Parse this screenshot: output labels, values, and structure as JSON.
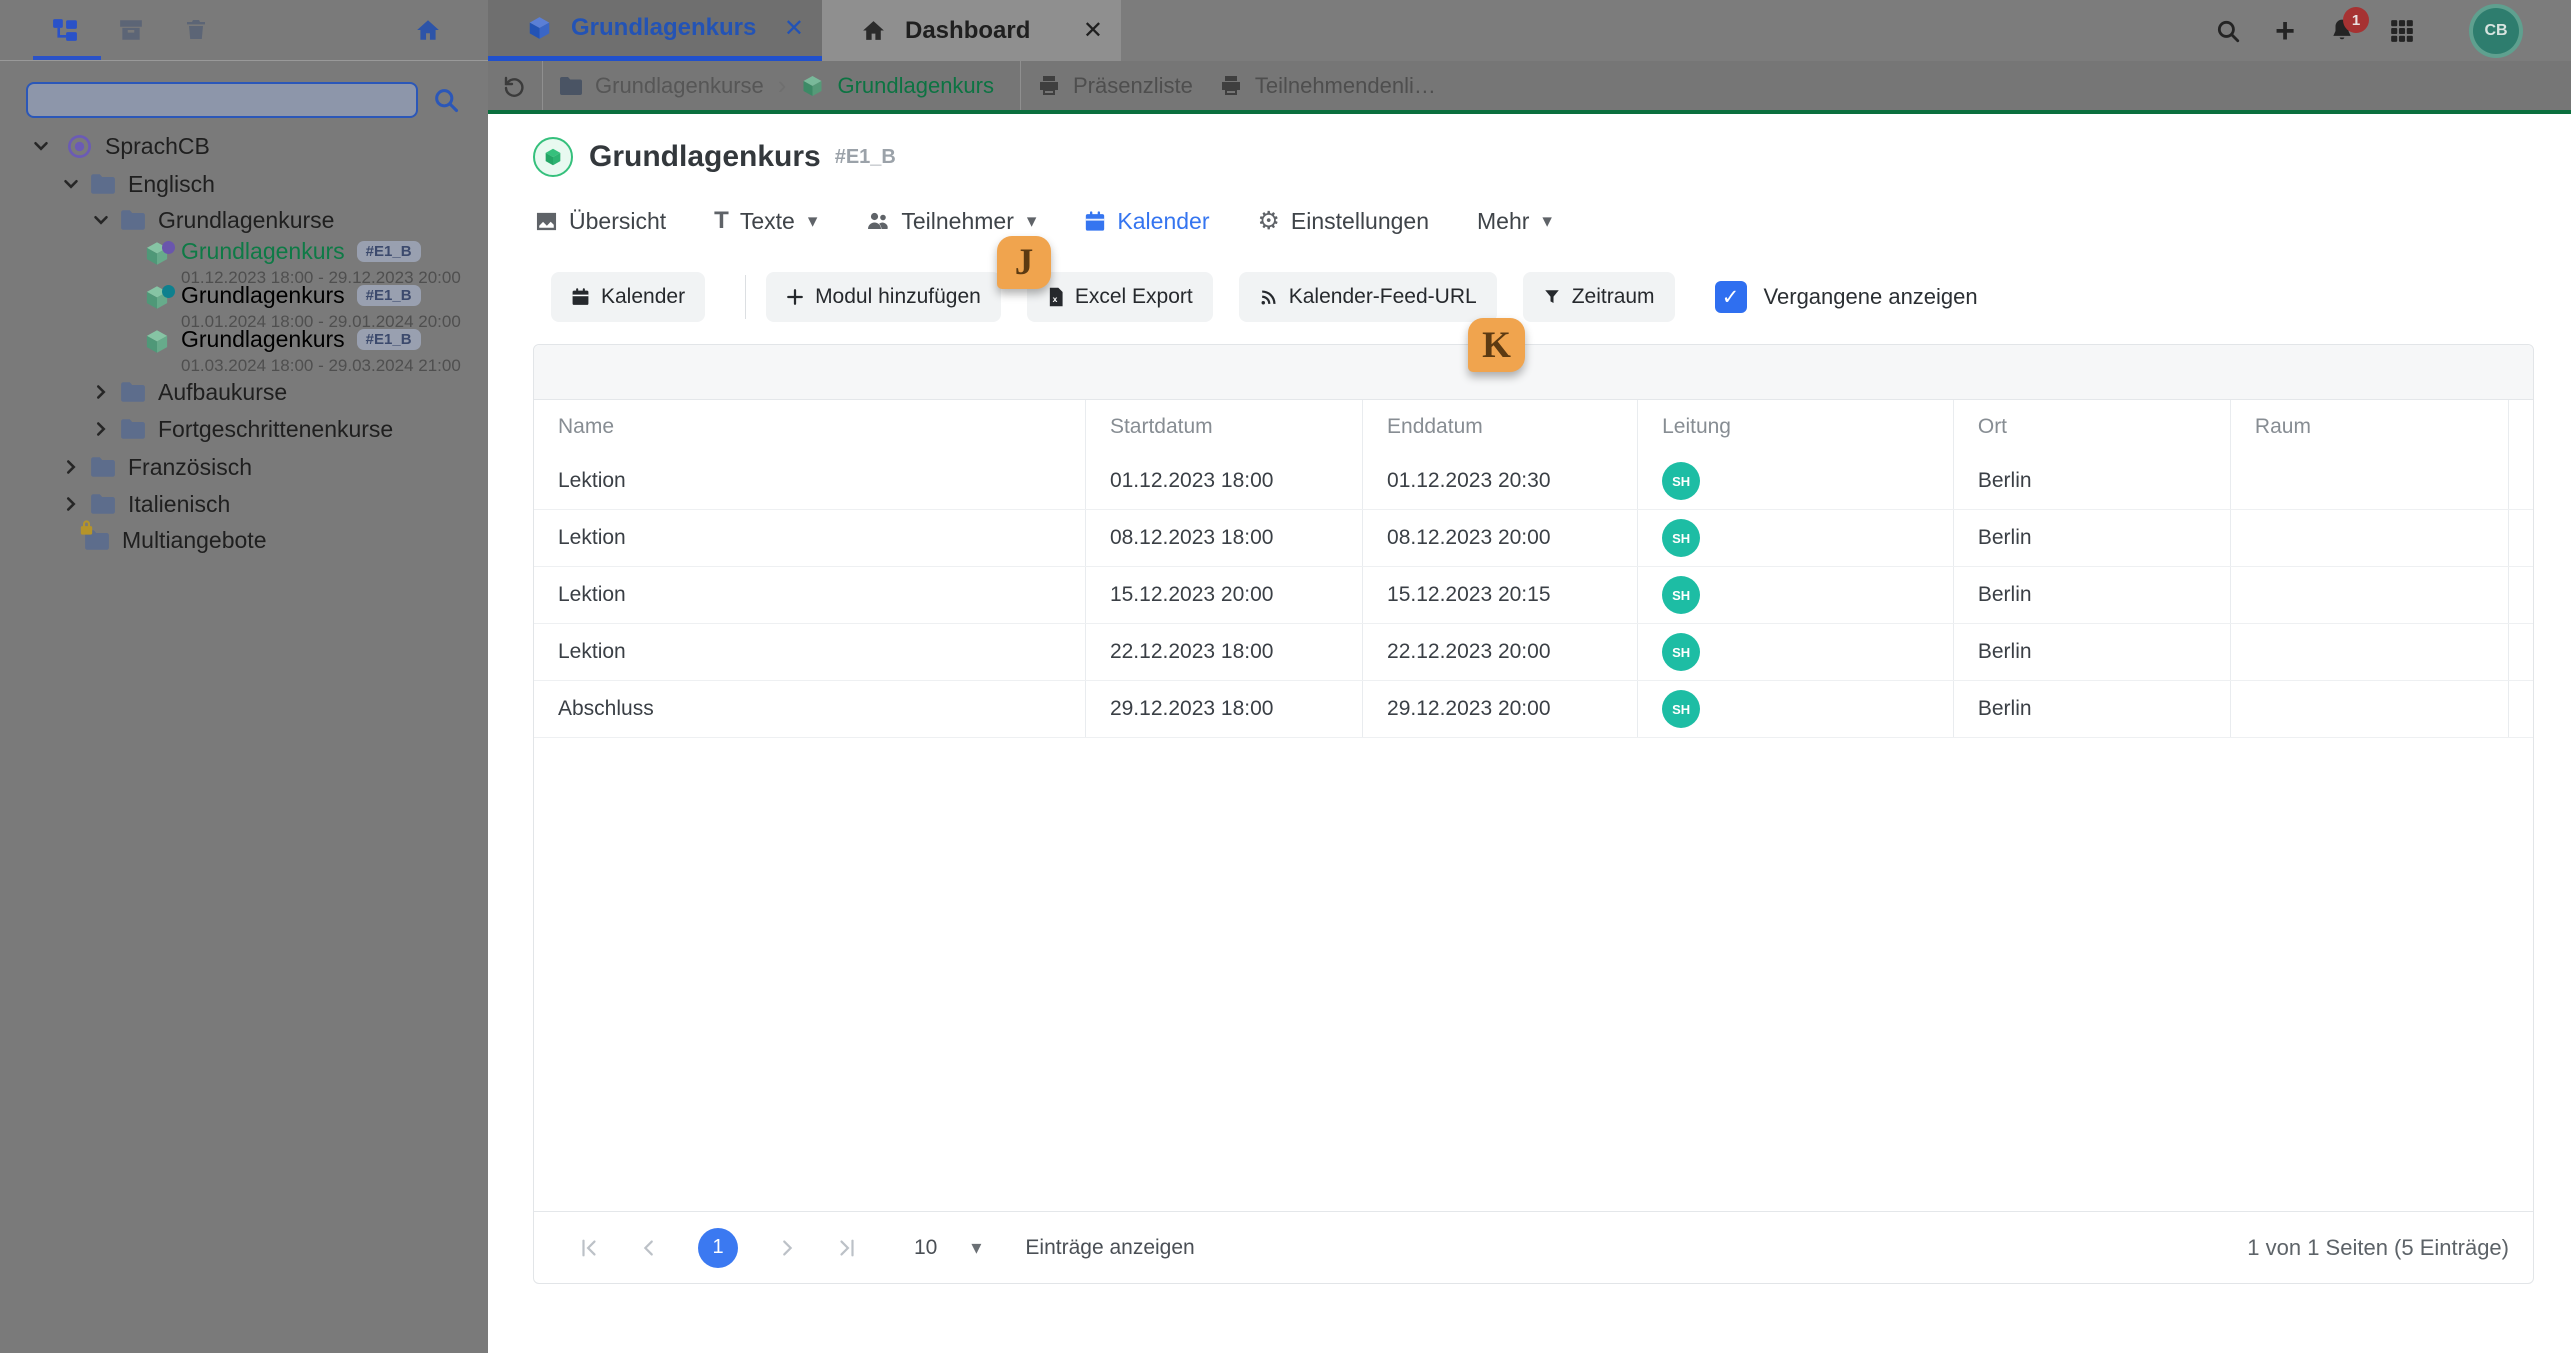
{
  "colors": {
    "accent_blue": "#3575f0",
    "brand_green": "#18a058",
    "avatar_teal": "#1dbda4",
    "marker_orange": "#f0a44e",
    "dim_overlay_gray": "#7a7a7a",
    "checkbox_blue": "#2f6ff0"
  },
  "topbar": {
    "notification_count": "1",
    "avatar_initials": "CB"
  },
  "window_tabs": [
    {
      "label": "Grundlagenkurs"
    },
    {
      "label": "Dashboard"
    }
  ],
  "breadcrumb": {
    "folder": "Grundlagenkurse",
    "course": "Grundlagenkurs",
    "print_a": "Präsenzliste",
    "print_b": "Teilnehmendenli…"
  },
  "sidebar": {
    "search_value": "",
    "tree": {
      "root": "SprachCB",
      "englisch": "Englisch",
      "grundlagenkurse": "Grundlagenkurse",
      "courses": [
        {
          "label": "Grundlagenkurs",
          "code": "#E1_B",
          "dates": "01.12.2023 18:00 - 29.12.2023 20:00"
        },
        {
          "label": "Grundlagenkurs",
          "code": "#E1_B",
          "dates": "01.01.2024 18:00 - 29.01.2024 20:00"
        },
        {
          "label": "Grundlagenkurs",
          "code": "#E1_B",
          "dates": "01.03.2024 18:00 - 29.03.2024 21:00"
        }
      ],
      "aufbaukurse": "Aufbaukurse",
      "fortgeschrittenenkurse": "Fortgeschrittenenkurse",
      "franzoesisch": "Französisch",
      "italienisch": "Italienisch",
      "multiangebote": "Multiangebote"
    }
  },
  "page": {
    "title": "Grundlagenkurs",
    "code": "#E1_B"
  },
  "nav_tabs": [
    {
      "label": "Übersicht"
    },
    {
      "label": "Texte"
    },
    {
      "label": "Teilnehmer"
    },
    {
      "label": "Kalender"
    },
    {
      "label": "Einstellungen"
    },
    {
      "label": "Mehr"
    }
  ],
  "toolbar": {
    "calendar_label": "Kalender",
    "add_module_label": "Modul hinzufügen",
    "excel_label": "Excel Export",
    "feed_label": "Kalender-Feed-URL",
    "range_label": "Zeitraum",
    "show_past_label": "Vergangene anzeigen",
    "show_past_checked": true
  },
  "table": {
    "columns": [
      "Name",
      "Startdatum",
      "Enddatum",
      "Leitung",
      "Ort",
      "Raum"
    ],
    "rows": [
      {
        "name": "Lektion",
        "start": "01.12.2023 18:00",
        "end": "01.12.2023 20:30",
        "leader": "SH",
        "ort": "Berlin",
        "raum": ""
      },
      {
        "name": "Lektion",
        "start": "08.12.2023 18:00",
        "end": "08.12.2023 20:00",
        "leader": "SH",
        "ort": "Berlin",
        "raum": ""
      },
      {
        "name": "Lektion",
        "start": "15.12.2023 20:00",
        "end": "15.12.2023 20:15",
        "leader": "SH",
        "ort": "Berlin",
        "raum": ""
      },
      {
        "name": "Lektion",
        "start": "22.12.2023 18:00",
        "end": "22.12.2023 20:00",
        "leader": "SH",
        "ort": "Berlin",
        "raum": ""
      },
      {
        "name": "Abschluss",
        "start": "29.12.2023 18:00",
        "end": "29.12.2023 20:00",
        "leader": "SH",
        "ort": "Berlin",
        "raum": ""
      }
    ]
  },
  "pagination": {
    "current_page": "1",
    "page_size": "10",
    "entries_label": "Einträge anzeigen",
    "summary": "1 von 1 Seiten (5 Einträge)"
  },
  "markers": [
    {
      "label": "J"
    },
    {
      "label": "K"
    }
  ],
  "icons": {
    "close": "✕",
    "plus": "+",
    "caret_down": "▾",
    "check": "✓",
    "gear": "⚙",
    "chevron_right": "›",
    "text": "T"
  }
}
